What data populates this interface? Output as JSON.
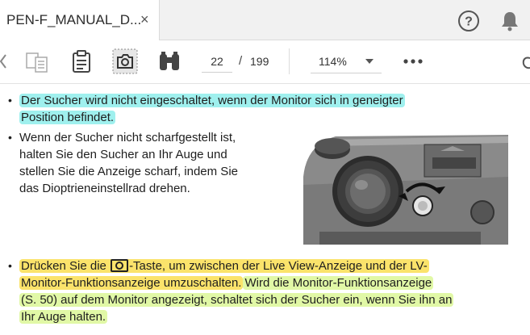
{
  "tab": {
    "title": "PEN-F_MANUAL_D...",
    "close_glyph": "×"
  },
  "header_icons": [
    "help-icon",
    "notification-bell-icon"
  ],
  "toolbar": {
    "icons": [
      "prev-chevron-icon",
      "compare-icon",
      "clipboard-icon",
      "snapshot-icon",
      "binoculars-icon"
    ],
    "current_page": "22",
    "page_separator": "/",
    "total_pages": "199",
    "zoom": "114%",
    "more_glyph": "•••"
  },
  "document": {
    "p1": {
      "line1": "Der Sucher wird nicht eingeschaltet, wenn der Monitor sich in geneigter",
      "line2": "Position befindet."
    },
    "p2": {
      "line1": "Wenn der Sucher nicht scharfgestellt ist,",
      "line2": "halten Sie den Sucher an Ihr Auge und",
      "line3": "stellen Sie die Anzeige scharf, indem Sie",
      "line4": "das Dioptrieneinstellrad drehen."
    },
    "p3": {
      "line1_a": "Drücken Sie die",
      "line1_b": "-Taste, um zwischen der Live View-Anzeige und der LV-",
      "line2_a": "Monitor-Funktionsanzeige umzuschalten.",
      "line2_b": "Wird die Monitor-Funktionsanzeige",
      "line3": "(S. 50) auf dem Monitor angezeigt, schaltet sich der Sucher ein, wenn Sie ihn an",
      "line4": "Ihr Auge halten."
    },
    "bullet": "•"
  },
  "colors": {
    "highlight_cyan": "#9ff0ee",
    "highlight_yellow": "#fbe36b",
    "highlight_green": "#e1f8a6"
  }
}
